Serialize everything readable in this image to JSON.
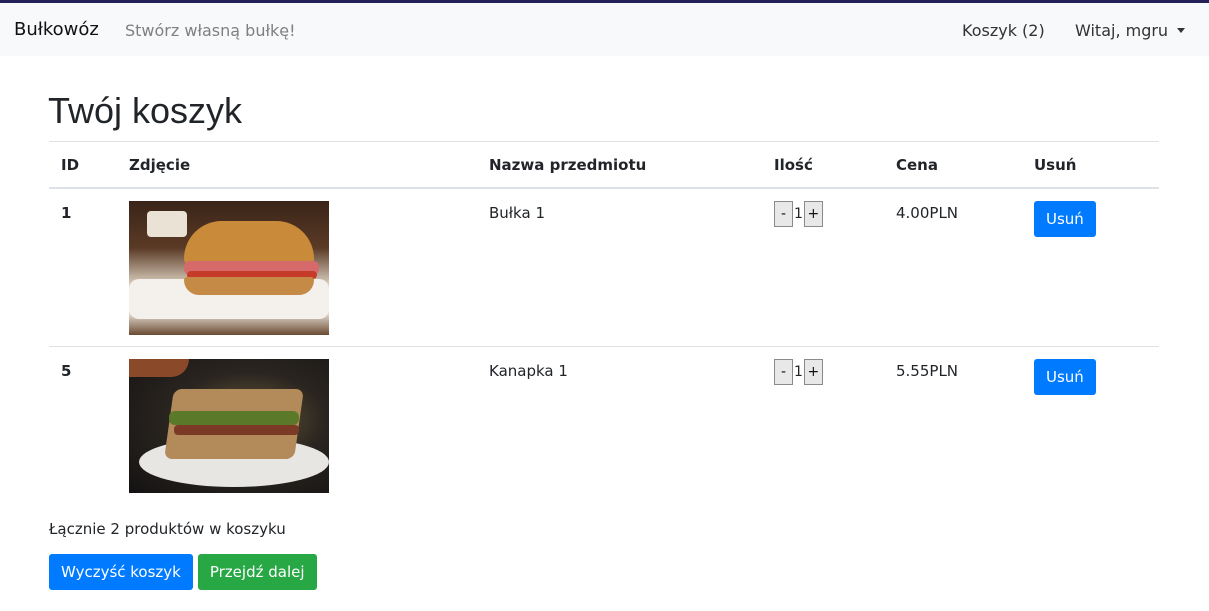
{
  "navbar": {
    "brand": "Bułkowóz",
    "tagline": "Stwórz własną bułkę!",
    "cart_link": "Koszyk (2)",
    "user_menu": "Witaj, mgru"
  },
  "page": {
    "title": "Twój koszyk"
  },
  "table": {
    "headers": [
      "ID",
      "Zdjęcie",
      "Nazwa przedmiotu",
      "Ilość",
      "Cena",
      "Usuń"
    ],
    "rows": [
      {
        "id": "1",
        "image": "sandwich-ham-photo",
        "name": "Bułka 1",
        "qty_minus": "-",
        "qty": "1",
        "qty_plus": "+",
        "price": "4.00PLN",
        "remove": "Usuń"
      },
      {
        "id": "5",
        "image": "sandwich-cut-photo",
        "name": "Kanapka 1",
        "qty_minus": "-",
        "qty": "1",
        "qty_plus": "+",
        "price": "5.55PLN",
        "remove": "Usuń"
      }
    ]
  },
  "summary": "Łącznie 2 produktów w koszyku",
  "actions": {
    "clear": "Wyczyść koszyk",
    "next": "Przejdź dalej"
  },
  "colors": {
    "primary": "#007bff",
    "success": "#28a745",
    "navbar_bg": "#f8f9fa",
    "topline": "#24205a"
  }
}
